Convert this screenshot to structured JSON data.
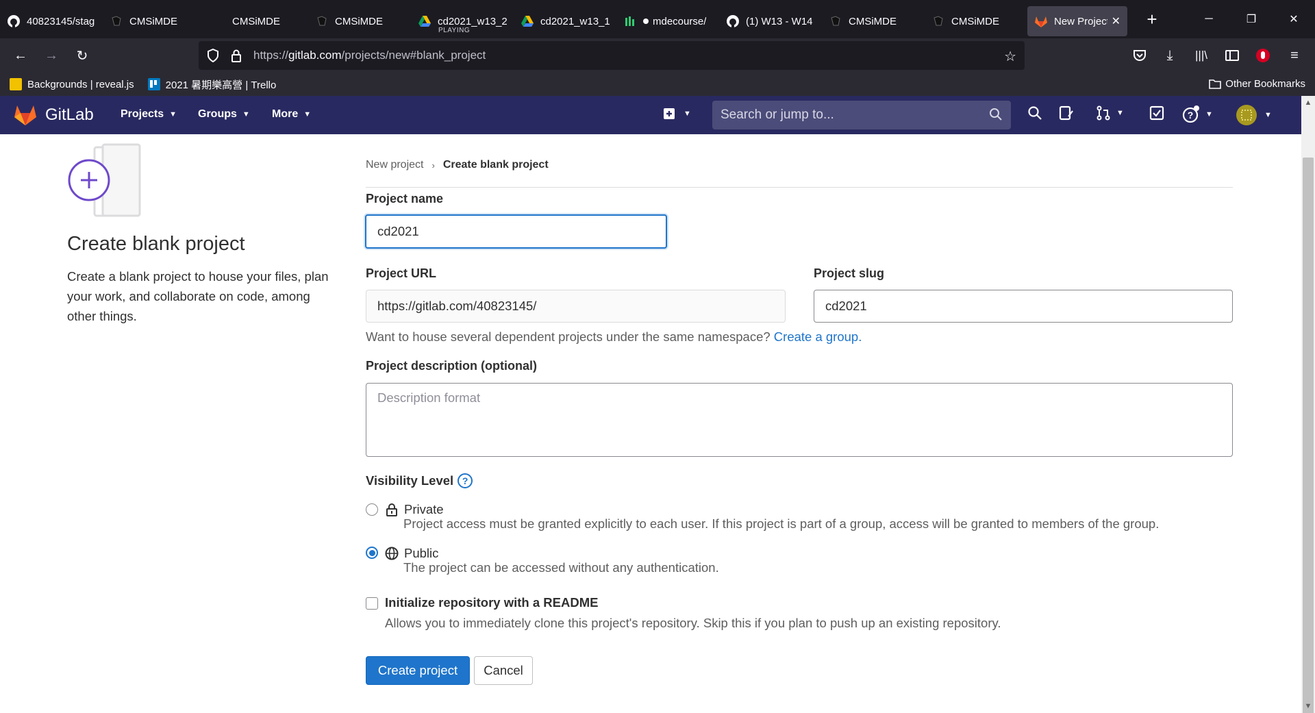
{
  "browser": {
    "tabs": [
      {
        "title": "40823145/stag",
        "icon": "github-icon"
      },
      {
        "title": "CMSiMDE",
        "icon": "cmsimde-icon"
      },
      {
        "title": "CMSiMDE",
        "icon": "blank-icon"
      },
      {
        "title": "CMSiMDE",
        "icon": "cmsimde-icon"
      },
      {
        "title": "cd2021_w13_2",
        "subtitle": "PLAYING",
        "icon": "google-drive-icon"
      },
      {
        "title": "cd2021_w13_1",
        "icon": "google-drive-icon"
      },
      {
        "title": "mdecourse/",
        "icon": "replit-icon"
      },
      {
        "title": "(1) W13 - W14",
        "icon": "github-icon"
      },
      {
        "title": "CMSiMDE",
        "icon": "cmsimde-icon"
      },
      {
        "title": "CMSiMDE",
        "icon": "cmsimde-icon"
      },
      {
        "title": "New Project",
        "icon": "gitlab-icon"
      }
    ],
    "url_prefix": "https://",
    "url_host": "gitlab.com",
    "url_path": "/projects/new#blank_project",
    "bookmarks": [
      {
        "label": "Backgrounds | reveal.js",
        "color": "#f2c200"
      },
      {
        "label": "2021 暑期樂高營 | Trello",
        "color": "#0079bf"
      }
    ],
    "other_bookmarks": "Other Bookmarks"
  },
  "gitlab": {
    "brand": "GitLab",
    "menu": [
      "Projects",
      "Groups",
      "More"
    ],
    "search_placeholder": "Search or jump to...",
    "colors": {
      "header": "#292961",
      "primary": "#1f75cb"
    }
  },
  "left": {
    "title": "Create blank project",
    "description": "Create a blank project to house your files, plan your work, and collaborate on code, among other things."
  },
  "breadcrumb": {
    "parent": "New project",
    "current": "Create blank project"
  },
  "form": {
    "name_label": "Project name",
    "name_value": "cd2021",
    "url_label": "Project URL",
    "url_value": "https://gitlab.com/40823145/",
    "slug_label": "Project slug",
    "slug_value": "cd2021",
    "group_hint": "Want to house several dependent projects under the same namespace?",
    "group_link": "Create a group.",
    "desc_label": "Project description (optional)",
    "desc_placeholder": "Description format",
    "visibility_label": "Visibility Level",
    "visibility": [
      {
        "title": "Private",
        "desc": "Project access must be granted explicitly to each user. If this project is part of a group, access will be granted to members of the group.",
        "selected": false
      },
      {
        "title": "Public",
        "desc": "The project can be accessed without any authentication.",
        "selected": true
      }
    ],
    "readme_label": "Initialize repository with a README",
    "readme_desc": "Allows you to immediately clone this project's repository. Skip this if you plan to push up an existing repository.",
    "create_button": "Create project",
    "cancel_button": "Cancel"
  }
}
